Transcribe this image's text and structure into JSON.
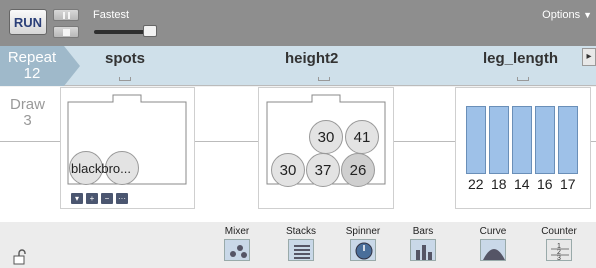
{
  "toolbar": {
    "run_label": "RUN",
    "speed_label": "Fastest",
    "options_label": "Options",
    "speed_fraction": 0.85
  },
  "header": {
    "repeat_label": "Repeat",
    "repeat_value": "12",
    "columns": [
      "spots",
      "height2",
      "leg_length"
    ]
  },
  "main": {
    "draw_label": "Draw",
    "draw_value": "3",
    "device1": {
      "balls": [
        "black",
        "bro..."
      ],
      "buttons": [
        "▾",
        "+",
        "−",
        "···"
      ]
    },
    "device2": {
      "balls": [
        "30",
        "41",
        "30",
        "37",
        "26"
      ]
    },
    "device3": {
      "values": [
        "22",
        "18",
        "14",
        "16",
        "17"
      ]
    }
  },
  "tools": [
    "Mixer",
    "Stacks",
    "Spinner",
    "Bars",
    "Curve",
    "Counter"
  ],
  "colors": {
    "toolbar": "#8e8e8e",
    "header": "#cfe0ea",
    "repeat": "#9fb9ca",
    "bar": "#9ec1e8",
    "run_text": "#2b3f78"
  }
}
